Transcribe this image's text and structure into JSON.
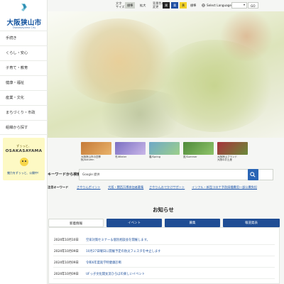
{
  "header": {
    "logo_title": "大阪狭山市",
    "logo_subtitle": "Osakasayama City"
  },
  "sidebar": {
    "items": [
      {
        "label": "手続き"
      },
      {
        "label": "くらし・安心"
      },
      {
        "label": "子育て・教育"
      },
      {
        "label": "健康・福祉"
      },
      {
        "label": "産業・文化"
      },
      {
        "label": "まちづくり・市政"
      },
      {
        "label": "組織から探す"
      }
    ],
    "promo": {
      "line1": "ずぅっと、",
      "line2": "OSAKASAYAMA",
      "line3": "魅力をずぅっと、公開中！"
    }
  },
  "topbar": {
    "font_size_label_1": "文字",
    "font_size_label_2": "サイズ",
    "font_standard": "標準",
    "font_enlarge": "拡大",
    "color_label_1": "背景色の",
    "color_label_2": "変更",
    "color_black": "黒",
    "color_blue": "青",
    "color_yellow": "黄",
    "color_standard": "標準",
    "language_label": "Select Language",
    "go_button": "GO"
  },
  "thumbnails": [
    {
      "caption_1": "大阪狭山市の四季",
      "caption_2": "秋/Autumn",
      "color": "#c57a38"
    },
    {
      "caption_1": "冬/Winter",
      "caption_2": "",
      "color": "#7b6fc2"
    },
    {
      "caption_1": "春/Spring",
      "caption_2": "",
      "color": "#6ea8c8"
    },
    {
      "caption_1": "夏/Summer",
      "caption_2": "",
      "color": "#4f8a3a"
    },
    {
      "caption_1": "大阪狭山ブランド",
      "caption_2": "大阪のお土産",
      "color": "#a8323c"
    }
  ],
  "search": {
    "label": "キーワードから検索",
    "badge": "Google 提供",
    "placeholder": ""
  },
  "keywords": {
    "label": "注目キーワード",
    "items": [
      "さやりんポイント",
      "大阪・関西万博参加者募集",
      "さやりんおでかけサポート",
      "インフル・新型コロナ予防接種費用一部公費負担"
    ]
  },
  "news": {
    "title": "お知らせ",
    "tabs": [
      "新着情報",
      "イベント",
      "募集",
      "報道発表"
    ],
    "items": [
      {
        "date": "2024年10月10日",
        "text": "空家対策セミナー＆個別相談会を開催します。"
      },
      {
        "date": "2024年10月09日",
        "text": "10月27日曜日に開催予定の防災フェスタを中止します"
      },
      {
        "date": "2024年10月09日",
        "text": "令和6年度就学時健康診断"
      },
      {
        "date": "2024年10月09日",
        "text": "UFっ子文化開女流ひろばの楽しいイベント"
      }
    ]
  }
}
